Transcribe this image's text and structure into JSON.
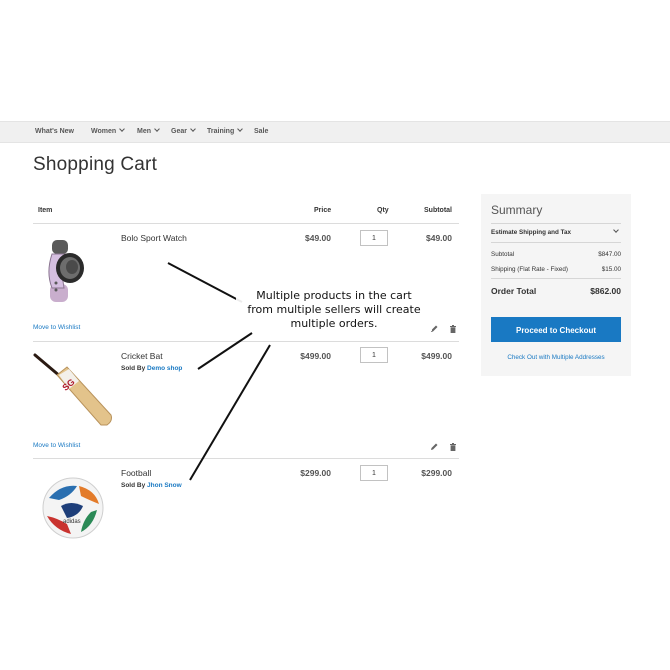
{
  "nav": {
    "items": [
      {
        "label": "What's New",
        "dropdown": false
      },
      {
        "label": "Women",
        "dropdown": true
      },
      {
        "label": "Men",
        "dropdown": true
      },
      {
        "label": "Gear",
        "dropdown": true
      },
      {
        "label": "Training",
        "dropdown": true
      },
      {
        "label": "Sale",
        "dropdown": false
      }
    ]
  },
  "page_title": "Shopping Cart",
  "table": {
    "headers": {
      "item": "Item",
      "price": "Price",
      "qty": "Qty",
      "subtotal": "Subtotal"
    },
    "rows": [
      {
        "name": "Bolo Sport Watch",
        "sold_by_label": "",
        "seller": "",
        "price": "$49.00",
        "qty": "1",
        "subtotal": "$49.00",
        "wishlist": "Move to Wishlist",
        "image": "watch-image"
      },
      {
        "name": "Cricket Bat",
        "sold_by_label": "Sold By",
        "seller": "Demo shop",
        "price": "$499.00",
        "qty": "1",
        "subtotal": "$499.00",
        "wishlist": "Move to Wishlist",
        "image": "cricket-bat-image"
      },
      {
        "name": "Football",
        "sold_by_label": "Sold By",
        "seller": "Jhon Snow",
        "price": "$299.00",
        "qty": "1",
        "subtotal": "$299.00",
        "wishlist": "",
        "image": "football-image"
      }
    ]
  },
  "summary": {
    "title": "Summary",
    "estimate_label": "Estimate Shipping and Tax",
    "subtotal_label": "Subtotal",
    "subtotal_value": "$847.00",
    "shipping_label": "Shipping (Flat Rate - Fixed)",
    "shipping_value": "$15.00",
    "order_total_label": "Order Total",
    "order_total_value": "$862.00",
    "checkout_button": "Proceed to Checkout",
    "multi_address_link": "Check Out with Multiple Addresses"
  },
  "callout": {
    "lines": [
      "Multiple products in the cart",
      "from multiple sellers will create",
      "multiple orders."
    ]
  },
  "colors": {
    "accent": "#1979c3",
    "nav_bg": "#f0f0f0",
    "summary_bg": "#f5f5f5"
  }
}
